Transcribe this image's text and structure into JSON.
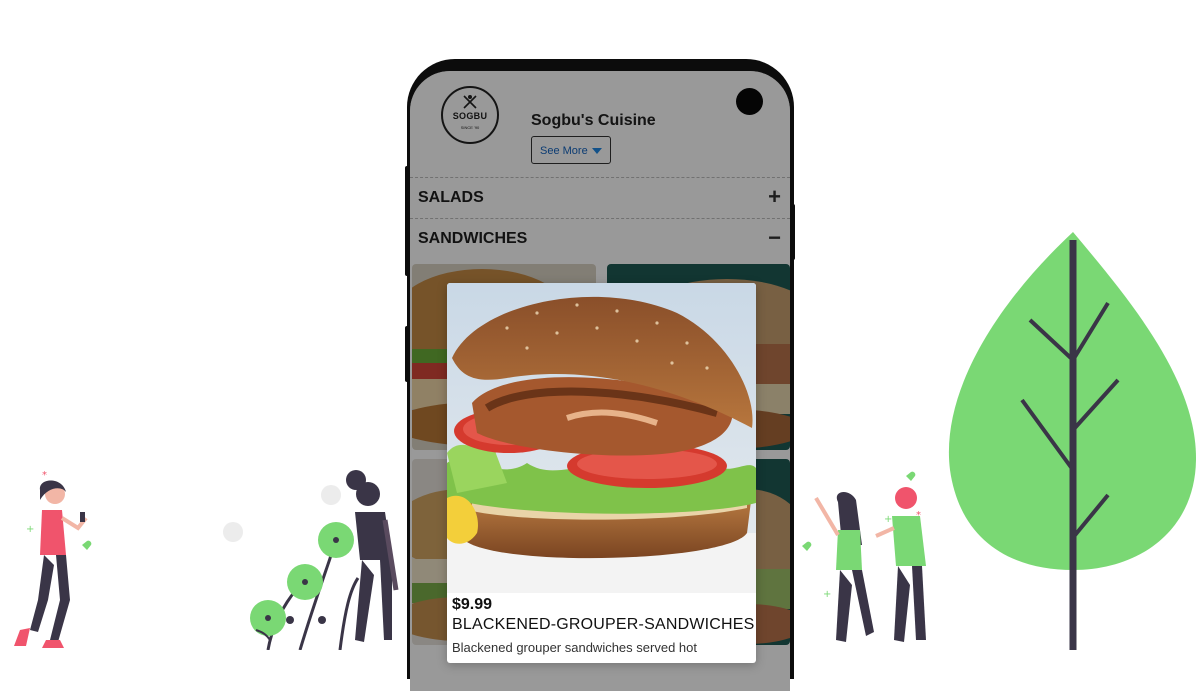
{
  "restaurant": {
    "logo_name": "SOGBU",
    "logo_tagline": "SINCE '90",
    "name": "Sogbu's Cuisine",
    "see_more_label": "See More"
  },
  "categories": [
    {
      "label": "SALADS",
      "toggle": "+",
      "state": "collapsed"
    },
    {
      "label": "SANDWICHES",
      "toggle": "−",
      "state": "expanded"
    }
  ],
  "selected_item": {
    "price": "$9.99",
    "name": "BLACKENED-GROUPER-SANDWICHES",
    "description": "Blackened grouper sandwiches served hot"
  },
  "colors": {
    "leaf_green": "#7ad874",
    "accent_pink": "#f0546c",
    "dark_figure": "#3a3547",
    "link_blue": "#1565c0"
  }
}
